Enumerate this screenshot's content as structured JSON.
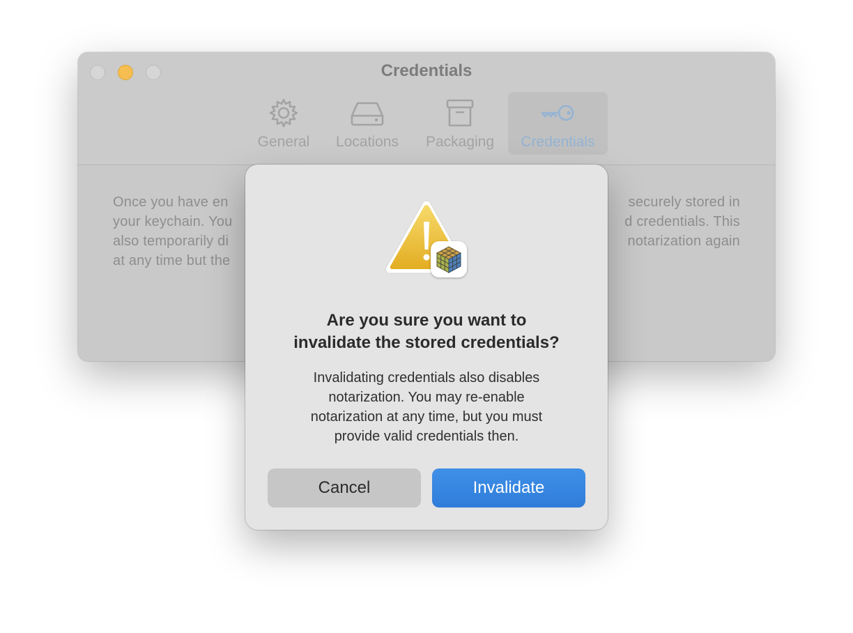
{
  "window": {
    "title": "Credentials",
    "tabs": [
      {
        "label": "General",
        "icon": "gear-icon"
      },
      {
        "label": "Locations",
        "icon": "drive-icon"
      },
      {
        "label": "Packaging",
        "icon": "archive-box-icon"
      },
      {
        "label": "Credentials",
        "icon": "key-icon",
        "selected": true
      }
    ],
    "body_lines": [
      {
        "left": "Once you have en",
        "right": "securely stored in"
      },
      {
        "left": "your keychain. You",
        "right": "d credentials. This"
      },
      {
        "left": "also temporarily di",
        "right": "notarization again"
      },
      {
        "left": "at any time but the",
        "right": ""
      }
    ]
  },
  "alert": {
    "icon": "warning-triangle-icon",
    "badge_icon": "app-cube-icon",
    "title_lines": [
      "Are you sure you want to",
      "invalidate the stored credentials?"
    ],
    "message_lines": [
      "Invalidating credentials also disables",
      "notarization. You may re-enable",
      "notarization at any time, but you must",
      "provide valid credentials then."
    ],
    "cancel_label": "Cancel",
    "confirm_label": "Invalidate"
  },
  "colors": {
    "accent": "#2f7dd9",
    "minimize": "#f6be50",
    "warning": "#f0c53a"
  }
}
